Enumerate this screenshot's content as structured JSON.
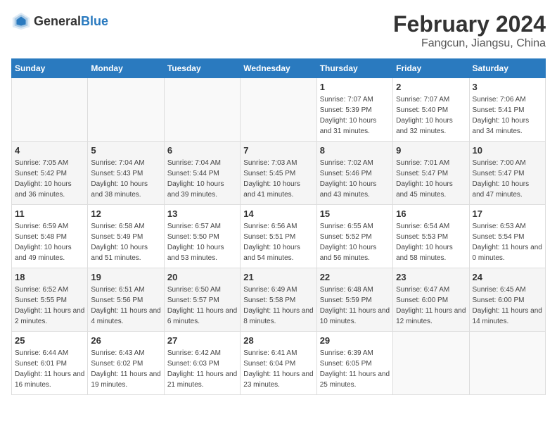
{
  "logo": {
    "text_general": "General",
    "text_blue": "Blue"
  },
  "title": "February 2024",
  "subtitle": "Fangcun, Jiangsu, China",
  "weekdays": [
    "Sunday",
    "Monday",
    "Tuesday",
    "Wednesday",
    "Thursday",
    "Friday",
    "Saturday"
  ],
  "weeks": [
    [
      {
        "day": "",
        "sunrise": "",
        "sunset": "",
        "daylight": ""
      },
      {
        "day": "",
        "sunrise": "",
        "sunset": "",
        "daylight": ""
      },
      {
        "day": "",
        "sunrise": "",
        "sunset": "",
        "daylight": ""
      },
      {
        "day": "",
        "sunrise": "",
        "sunset": "",
        "daylight": ""
      },
      {
        "day": "1",
        "sunrise": "Sunrise: 7:07 AM",
        "sunset": "Sunset: 5:39 PM",
        "daylight": "Daylight: 10 hours and 31 minutes."
      },
      {
        "day": "2",
        "sunrise": "Sunrise: 7:07 AM",
        "sunset": "Sunset: 5:40 PM",
        "daylight": "Daylight: 10 hours and 32 minutes."
      },
      {
        "day": "3",
        "sunrise": "Sunrise: 7:06 AM",
        "sunset": "Sunset: 5:41 PM",
        "daylight": "Daylight: 10 hours and 34 minutes."
      }
    ],
    [
      {
        "day": "4",
        "sunrise": "Sunrise: 7:05 AM",
        "sunset": "Sunset: 5:42 PM",
        "daylight": "Daylight: 10 hours and 36 minutes."
      },
      {
        "day": "5",
        "sunrise": "Sunrise: 7:04 AM",
        "sunset": "Sunset: 5:43 PM",
        "daylight": "Daylight: 10 hours and 38 minutes."
      },
      {
        "day": "6",
        "sunrise": "Sunrise: 7:04 AM",
        "sunset": "Sunset: 5:44 PM",
        "daylight": "Daylight: 10 hours and 39 minutes."
      },
      {
        "day": "7",
        "sunrise": "Sunrise: 7:03 AM",
        "sunset": "Sunset: 5:45 PM",
        "daylight": "Daylight: 10 hours and 41 minutes."
      },
      {
        "day": "8",
        "sunrise": "Sunrise: 7:02 AM",
        "sunset": "Sunset: 5:46 PM",
        "daylight": "Daylight: 10 hours and 43 minutes."
      },
      {
        "day": "9",
        "sunrise": "Sunrise: 7:01 AM",
        "sunset": "Sunset: 5:47 PM",
        "daylight": "Daylight: 10 hours and 45 minutes."
      },
      {
        "day": "10",
        "sunrise": "Sunrise: 7:00 AM",
        "sunset": "Sunset: 5:47 PM",
        "daylight": "Daylight: 10 hours and 47 minutes."
      }
    ],
    [
      {
        "day": "11",
        "sunrise": "Sunrise: 6:59 AM",
        "sunset": "Sunset: 5:48 PM",
        "daylight": "Daylight: 10 hours and 49 minutes."
      },
      {
        "day": "12",
        "sunrise": "Sunrise: 6:58 AM",
        "sunset": "Sunset: 5:49 PM",
        "daylight": "Daylight: 10 hours and 51 minutes."
      },
      {
        "day": "13",
        "sunrise": "Sunrise: 6:57 AM",
        "sunset": "Sunset: 5:50 PM",
        "daylight": "Daylight: 10 hours and 53 minutes."
      },
      {
        "day": "14",
        "sunrise": "Sunrise: 6:56 AM",
        "sunset": "Sunset: 5:51 PM",
        "daylight": "Daylight: 10 hours and 54 minutes."
      },
      {
        "day": "15",
        "sunrise": "Sunrise: 6:55 AM",
        "sunset": "Sunset: 5:52 PM",
        "daylight": "Daylight: 10 hours and 56 minutes."
      },
      {
        "day": "16",
        "sunrise": "Sunrise: 6:54 AM",
        "sunset": "Sunset: 5:53 PM",
        "daylight": "Daylight: 10 hours and 58 minutes."
      },
      {
        "day": "17",
        "sunrise": "Sunrise: 6:53 AM",
        "sunset": "Sunset: 5:54 PM",
        "daylight": "Daylight: 11 hours and 0 minutes."
      }
    ],
    [
      {
        "day": "18",
        "sunrise": "Sunrise: 6:52 AM",
        "sunset": "Sunset: 5:55 PM",
        "daylight": "Daylight: 11 hours and 2 minutes."
      },
      {
        "day": "19",
        "sunrise": "Sunrise: 6:51 AM",
        "sunset": "Sunset: 5:56 PM",
        "daylight": "Daylight: 11 hours and 4 minutes."
      },
      {
        "day": "20",
        "sunrise": "Sunrise: 6:50 AM",
        "sunset": "Sunset: 5:57 PM",
        "daylight": "Daylight: 11 hours and 6 minutes."
      },
      {
        "day": "21",
        "sunrise": "Sunrise: 6:49 AM",
        "sunset": "Sunset: 5:58 PM",
        "daylight": "Daylight: 11 hours and 8 minutes."
      },
      {
        "day": "22",
        "sunrise": "Sunrise: 6:48 AM",
        "sunset": "Sunset: 5:59 PM",
        "daylight": "Daylight: 11 hours and 10 minutes."
      },
      {
        "day": "23",
        "sunrise": "Sunrise: 6:47 AM",
        "sunset": "Sunset: 6:00 PM",
        "daylight": "Daylight: 11 hours and 12 minutes."
      },
      {
        "day": "24",
        "sunrise": "Sunrise: 6:45 AM",
        "sunset": "Sunset: 6:00 PM",
        "daylight": "Daylight: 11 hours and 14 minutes."
      }
    ],
    [
      {
        "day": "25",
        "sunrise": "Sunrise: 6:44 AM",
        "sunset": "Sunset: 6:01 PM",
        "daylight": "Daylight: 11 hours and 16 minutes."
      },
      {
        "day": "26",
        "sunrise": "Sunrise: 6:43 AM",
        "sunset": "Sunset: 6:02 PM",
        "daylight": "Daylight: 11 hours and 19 minutes."
      },
      {
        "day": "27",
        "sunrise": "Sunrise: 6:42 AM",
        "sunset": "Sunset: 6:03 PM",
        "daylight": "Daylight: 11 hours and 21 minutes."
      },
      {
        "day": "28",
        "sunrise": "Sunrise: 6:41 AM",
        "sunset": "Sunset: 6:04 PM",
        "daylight": "Daylight: 11 hours and 23 minutes."
      },
      {
        "day": "29",
        "sunrise": "Sunrise: 6:39 AM",
        "sunset": "Sunset: 6:05 PM",
        "daylight": "Daylight: 11 hours and 25 minutes."
      },
      {
        "day": "",
        "sunrise": "",
        "sunset": "",
        "daylight": ""
      },
      {
        "day": "",
        "sunrise": "",
        "sunset": "",
        "daylight": ""
      }
    ]
  ]
}
